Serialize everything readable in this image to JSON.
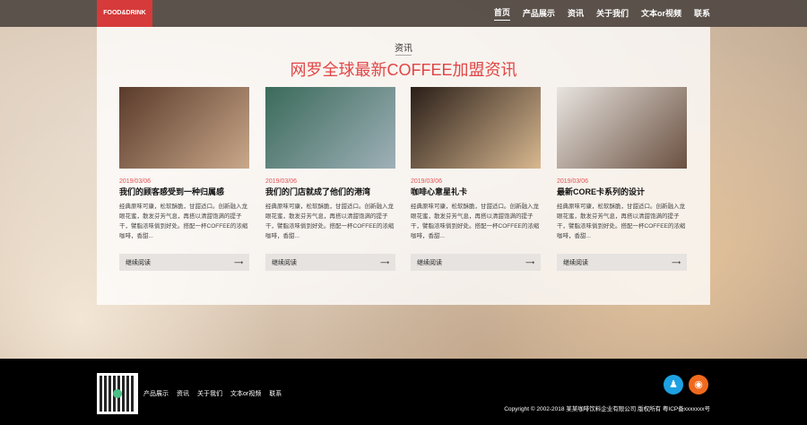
{
  "header": {
    "logo": "FOOD&DRINK",
    "nav": [
      "首页",
      "产品展示",
      "资讯",
      "关于我们",
      "文本or视频",
      "联系"
    ]
  },
  "main": {
    "section": "资讯",
    "headline": "网罗全球最新COFFEE加盟资讯",
    "cards": [
      {
        "date": "2019/03/06",
        "title": "我们的顾客感受到一种归属感",
        "desc": "经典原味可康，松软酥脆，甘甜适口。创新融入龙眼花蜜，散发芬芳气息，再搭以清甜饱满的提子干，譬脂浓味倘到好处。搭配一杯COFFEE的浓缩咖啡，香甜...",
        "more": "继续阅读",
        "img": [
          "#5a3a2a",
          "#c9a88a"
        ]
      },
      {
        "date": "2019/03/06",
        "title": "我们的门店就成了他们的港湾",
        "desc": "经典原味可康，松软酥脆，甘甜适口。创新融入龙眼花蜜，散发芬芳气息，再搭以清甜饱满的提子干，譬脂浓味倘到好处。搭配一杯COFFEE的浓缩咖啡，香甜...",
        "more": "继续阅读",
        "img": [
          "#3a6a5a",
          "#9fb0b8"
        ]
      },
      {
        "date": "2019/03/06",
        "title": "咖啡心意星礼卡",
        "desc": "经典原味可康，松软酥脆，甘甜适口。创新融入龙眼花蜜，散发芬芳气息，再搭以清甜饱满的提子干，譬脂浓味倘到好处。搭配一杯COFFEE的浓缩咖啡，香甜...",
        "more": "继续阅读",
        "img": [
          "#2a1e18",
          "#d8b890"
        ]
      },
      {
        "date": "2019/03/06",
        "title": "最新CORE卡系列的设计",
        "desc": "经典原味可康，松软酥脆，甘甜适口。创新融入龙眼花蜜，散发芬芳气息，再搭以清甜饱满的提子干，譬脂浓味倘到好处。搭配一杯COFFEE的浓缩咖啡，香甜...",
        "more": "继续阅读",
        "img": [
          "#e8e4e0",
          "#6a5040"
        ]
      }
    ]
  },
  "footer": {
    "links": [
      "产品展示",
      "资讯",
      "关于我们",
      "文本or视频",
      "联系"
    ],
    "copyright": "Copyright © 2002-2018 某某咖啡饮料企业有限公司 版权所有 粤ICP备xxxxxxx号",
    "qq_color": "#1da1e2",
    "weibo_color": "#f06a1e"
  }
}
